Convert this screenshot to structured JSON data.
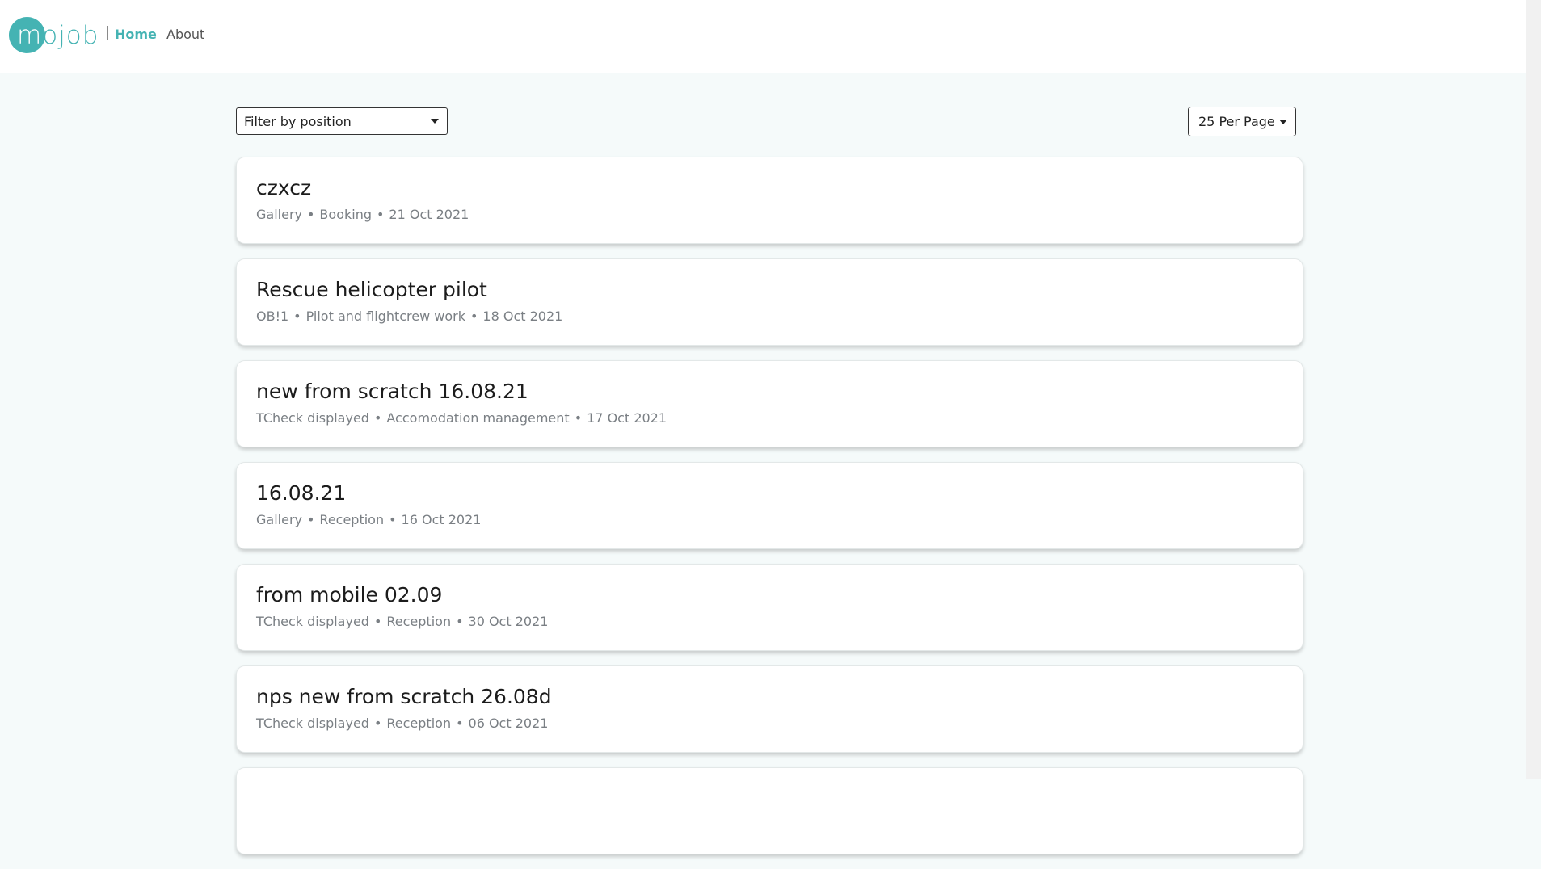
{
  "nav": {
    "logo_text": "mojob",
    "separator": "|",
    "home_label": "Home",
    "about_label": "About",
    "accent_color": "#45b3b3"
  },
  "filters": {
    "position_placeholder": "Filter by position",
    "per_page_label": "25 Per Page"
  },
  "jobs": [
    {
      "title": "czxcz",
      "company": "Gallery",
      "category": "Booking",
      "date": "21 Oct 2021"
    },
    {
      "title": "Rescue helicopter pilot",
      "company": "OB!1",
      "category": "Pilot and flightcrew work",
      "date": "18 Oct 2021"
    },
    {
      "title": "new from scratch 16.08.21",
      "company": "TCheck displayed",
      "category": "Accomodation management",
      "date": "17 Oct 2021"
    },
    {
      "title": "16.08.21",
      "company": "Gallery",
      "category": "Reception",
      "date": "16 Oct 2021"
    },
    {
      "title": "from mobile 02.09",
      "company": "TCheck displayed",
      "category": "Reception",
      "date": "30 Oct 2021"
    },
    {
      "title": "nps new from scratch 26.08d",
      "company": "TCheck displayed",
      "category": "Reception",
      "date": "06 Oct 2021"
    },
    {
      "title": "",
      "company": "",
      "category": "",
      "date": ""
    }
  ]
}
